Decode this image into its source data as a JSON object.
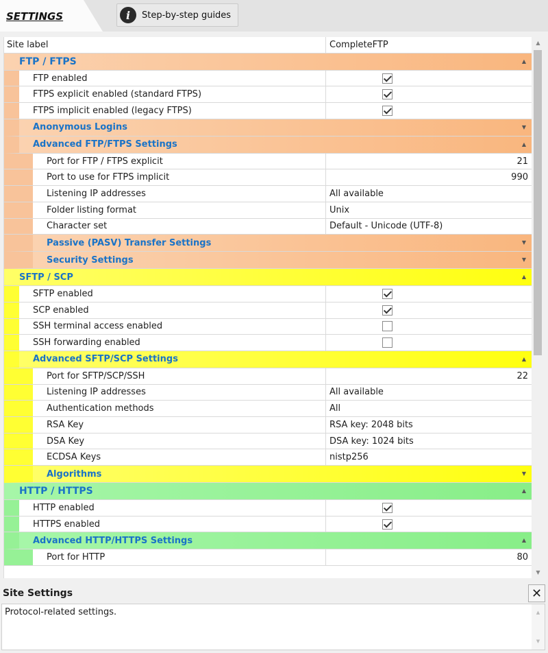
{
  "tabs": {
    "settings": "SETTINGS",
    "guides": "Step-by-step guides"
  },
  "grid": {
    "site_label": {
      "name": "Site label",
      "value": "CompleteFTP"
    },
    "ftp": {
      "title": "FTP / FTPS",
      "rows": [
        {
          "name": "FTP enabled",
          "checked": true
        },
        {
          "name": "FTPS explicit enabled (standard FTPS)",
          "checked": true
        },
        {
          "name": "FTPS implicit enabled (legacy FTPS)",
          "checked": true
        }
      ],
      "anonymous": "Anonymous Logins",
      "advanced": {
        "title": "Advanced FTP/FTPS Settings",
        "rows": [
          {
            "name": "Port for FTP / FTPS explicit",
            "value": "21"
          },
          {
            "name": "Port to use for FTPS implicit",
            "value": "990"
          },
          {
            "name": "Listening IP addresses",
            "value": "All available"
          },
          {
            "name": "Folder listing format",
            "value": "Unix"
          },
          {
            "name": "Character set",
            "value": "Default - Unicode (UTF-8)"
          }
        ],
        "passive": "Passive (PASV) Transfer Settings",
        "security": "Security Settings"
      }
    },
    "sftp": {
      "title": "SFTP / SCP",
      "rows": [
        {
          "name": "SFTP enabled",
          "checked": true
        },
        {
          "name": "SCP enabled",
          "checked": true
        },
        {
          "name": "SSH terminal access enabled",
          "checked": false
        },
        {
          "name": "SSH forwarding enabled",
          "checked": false
        }
      ],
      "advanced": {
        "title": "Advanced SFTP/SCP Settings",
        "rows": [
          {
            "name": "Port for SFTP/SCP/SSH",
            "value": "22"
          },
          {
            "name": "Listening IP addresses",
            "value": "All available"
          },
          {
            "name": "Authentication methods",
            "value": "All"
          },
          {
            "name": "RSA Key",
            "value": "RSA key: 2048 bits"
          },
          {
            "name": "DSA Key",
            "value": "DSA key: 1024 bits"
          },
          {
            "name": "ECDSA Keys",
            "value": "nistp256"
          }
        ],
        "algorithms": "Algorithms"
      }
    },
    "http": {
      "title": "HTTP / HTTPS",
      "rows": [
        {
          "name": "HTTP enabled",
          "checked": true
        },
        {
          "name": "HTTPS enabled",
          "checked": true
        }
      ],
      "advanced": {
        "title": "Advanced HTTP/HTTPS Settings",
        "rows": [
          {
            "name": "Port for HTTP",
            "value": "80"
          }
        ]
      }
    }
  },
  "description": {
    "title": "Site Settings",
    "text": "Protocol-related settings.",
    "close": "✕"
  }
}
